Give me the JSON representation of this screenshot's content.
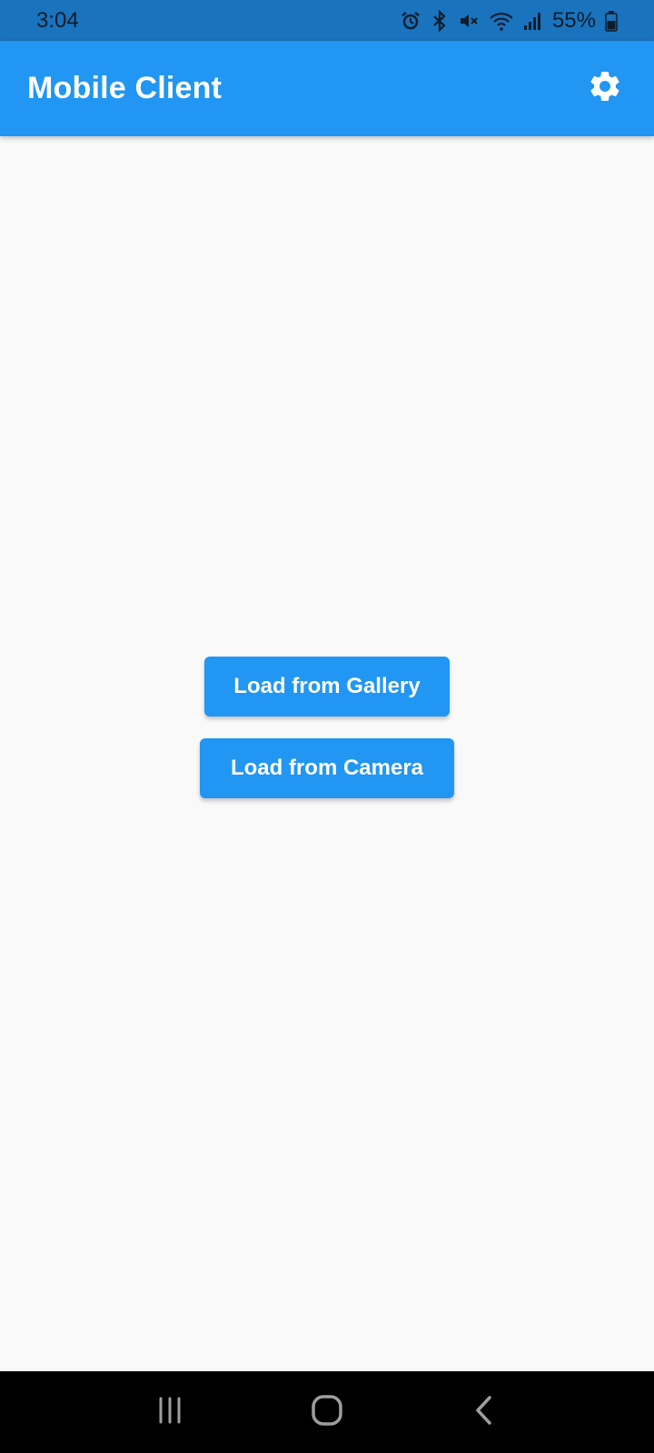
{
  "status_bar": {
    "time": "3:04",
    "battery": "55%",
    "icons": [
      "alarm-icon",
      "bluetooth-icon",
      "mute-icon",
      "wifi-icon",
      "signal-icon",
      "battery-icon"
    ]
  },
  "app_bar": {
    "title": "Mobile Client",
    "settings_icon": "gear-icon",
    "color": "#2196f3"
  },
  "main": {
    "gallery_button": "Load from Gallery",
    "camera_button": "Load from Camera"
  },
  "nav_bar": {
    "icons": [
      "recent-apps-icon",
      "home-icon",
      "back-icon"
    ]
  }
}
